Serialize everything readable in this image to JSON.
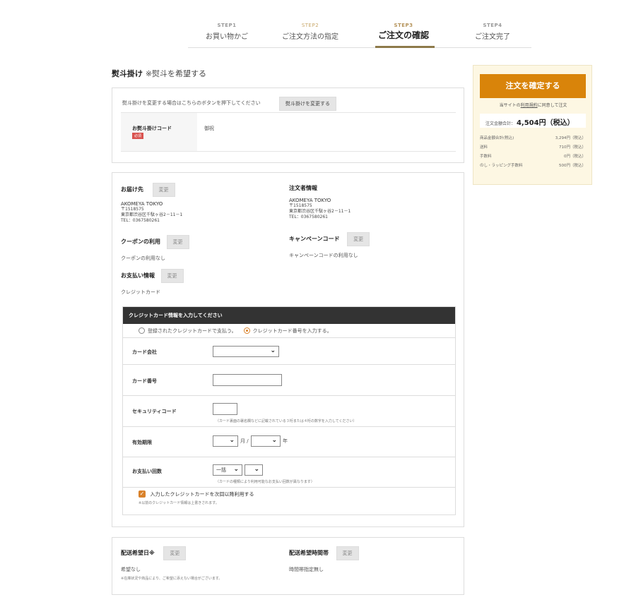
{
  "steps": [
    {
      "num": "STEP1",
      "name": "お買い物かご"
    },
    {
      "num": "STEP2",
      "name": "ご注文方法の指定"
    },
    {
      "num": "STEP3",
      "name": "ご注文の確認"
    },
    {
      "num": "STEP4",
      "name": "ご注文完了"
    }
  ],
  "noshi": {
    "title": "熨斗掛け",
    "title_note": "※熨斗を希望する",
    "message": "熨斗掛けを変更する場合はこちらのボタンを押下してください",
    "change_button": "熨斗掛けを変更する",
    "code_label": "お熨斗掛けコード",
    "required_badge": "必須",
    "code_value": "御祝"
  },
  "info": {
    "change_label": "変更",
    "delivery": {
      "title": "お届け先",
      "name": "AKOMEYA TOKYO",
      "postal": "〒1518575",
      "address": "東京都渋谷区千駄ヶ谷2－11－1",
      "tel": "TEL：0367580261"
    },
    "orderer": {
      "title": "注文者情報",
      "name": "AKOMEYA TOKYO",
      "postal": "〒1518575",
      "address": "東京都渋谷区千駄ヶ谷2－11－1",
      "tel": "TEL：0367580261"
    },
    "coupon": {
      "title": "クーポンの利用",
      "value": "クーポンの利用なし"
    },
    "campaign": {
      "title": "キャンペーンコード",
      "value": "キャンペーンコードの利用なし"
    },
    "payment": {
      "title": "お支払い情報",
      "value": "クレジットカード"
    }
  },
  "credit": {
    "header": "クレジットカード情報を入力してください",
    "radio_registered": "登録されたクレジットカードで支払う。",
    "radio_new": "クレジットカード番号を入力する。",
    "card_company_label": "カード会社",
    "card_number_label": "カード番号",
    "security_label": "セキュリティコード",
    "security_hint": "（カード裏面の署名欄などに記載されている３桁または４桁の数字を入力してください）",
    "expiry_label": "有効期限",
    "expiry_month_unit": "月 /",
    "expiry_year_unit": "年",
    "installment_label": "お支払い回数",
    "installment_value": "一括",
    "installment_hint": "（カードの種類により利用可能なお支払い回数が異なります）",
    "save_label": "入力したクレジットカードを次回以降利用する",
    "save_note": "※以前のクレジットカード情報は上書きされます。",
    "save_checked": true
  },
  "shipping": {
    "date_title": "配送希望日※",
    "date_value": "希望なし",
    "date_note": "※在庫状況や商品により、ご希望に添えない場合がございます。",
    "time_title": "配送希望時間帯",
    "time_value": "時間帯指定無し"
  },
  "summary": {
    "confirm_button": "注文を確定する",
    "agree_prefix": "当サイトの",
    "agree_link": "利用規約",
    "agree_suffix": "に同意して注文",
    "total_label": "注文金額合計：",
    "total_value": "4,504円（税込）",
    "rows": [
      {
        "label": "商品金額合計(税込)",
        "value": "3,294円（税込）"
      },
      {
        "label": "送料",
        "value": "710円（税込）"
      },
      {
        "label": "手数料",
        "value": "0円（税込）"
      },
      {
        "label": "のし・ラッピング手数料",
        "value": "500円（税込）"
      }
    ]
  }
}
